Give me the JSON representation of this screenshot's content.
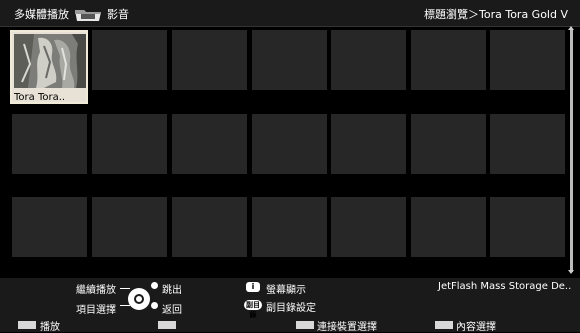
{
  "header": {
    "title_left": "多媒體播放",
    "title_section": "影音",
    "breadcrumb": "標題瀏覽＞Tora Tora Gold V"
  },
  "grid": {
    "items": [
      {
        "label": "Tora Tora..",
        "selected": true
      }
    ]
  },
  "footer": {
    "continue_play": "繼續播放",
    "item_select": "項目選擇",
    "jump_out": "跳出",
    "go_back": "返回",
    "info_button": "i",
    "screen_display": "螢幕顯示",
    "sub_button": "副目錄",
    "subdir_settings": "副目錄設定",
    "device_name": "JetFlash Mass Storage De..",
    "color_buttons": [
      {
        "label": "播放"
      },
      {
        "label": ""
      },
      {
        "label": "連接裝置選擇"
      },
      {
        "label": "內容選擇"
      }
    ]
  }
}
